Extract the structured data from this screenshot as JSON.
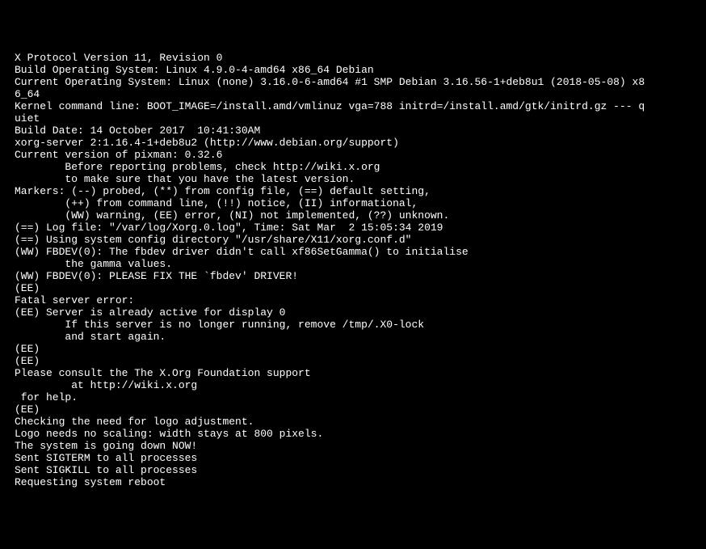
{
  "lines": [
    "X Protocol Version 11, Revision 0",
    "Build Operating System: Linux 4.9.0-4-amd64 x86_64 Debian",
    "Current Operating System: Linux (none) 3.16.0-6-amd64 #1 SMP Debian 3.16.56-1+deb8u1 (2018-05-08) x8",
    "6_64",
    "Kernel command line: BOOT_IMAGE=/install.amd/vmlinuz vga=788 initrd=/install.amd/gtk/initrd.gz --- q",
    "uiet",
    "Build Date: 14 October 2017  10:41:30AM",
    "xorg-server 2:1.16.4-1+deb8u2 (http://www.debian.org/support)",
    "Current version of pixman: 0.32.6",
    "        Before reporting problems, check http://wiki.x.org",
    "        to make sure that you have the latest version.",
    "Markers: (--) probed, (**) from config file, (==) default setting,",
    "        (++) from command line, (!!) notice, (II) informational,",
    "        (WW) warning, (EE) error, (NI) not implemented, (??) unknown.",
    "(==) Log file: \"/var/log/Xorg.0.log\", Time: Sat Mar  2 15:05:34 2019",
    "(==) Using system config directory \"/usr/share/X11/xorg.conf.d\"",
    "(WW) FBDEV(0): The fbdev driver didn't call xf86SetGamma() to initialise",
    "        the gamma values.",
    "(WW) FBDEV(0): PLEASE FIX THE `fbdev' DRIVER!",
    "(EE)",
    "Fatal server error:",
    "(EE) Server is already active for display 0",
    "        If this server is no longer running, remove /tmp/.X0-lock",
    "        and start again.",
    "(EE)",
    "(EE)",
    "Please consult the The X.Org Foundation support",
    "         at http://wiki.x.org",
    " for help.",
    "(EE)",
    "Checking the need for logo adjustment.",
    "Logo needs no scaling: width stays at 800 pixels.",
    "The system is going down NOW!",
    "Sent SIGTERM to all processes",
    "Sent SIGKILL to all processes",
    "Requesting system reboot"
  ]
}
